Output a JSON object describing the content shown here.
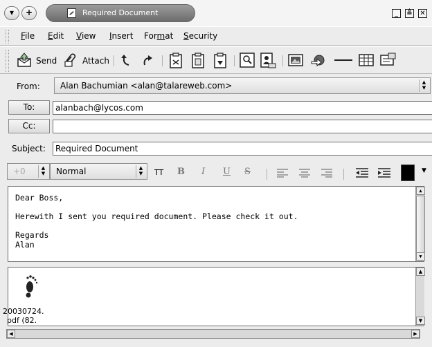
{
  "window": {
    "title": "Required Document"
  },
  "menu": {
    "file": "ile",
    "edit": "dit",
    "view": "iew",
    "insert": "nsert",
    "format_a": "For",
    "format_b": "at",
    "security": "ecurity",
    "file_key": "F",
    "edit_key": "E",
    "view_key": "V",
    "insert_key": "I",
    "format_key": "m",
    "security_key": "S"
  },
  "toolbar": {
    "send_label": "Send",
    "attach_label": "Attach"
  },
  "compose": {
    "from_label": "From:",
    "from_value": "Alan Bachumian <alan@talareweb.com>",
    "to_button": "To:",
    "to_value": "alanbach@lycos.com",
    "cc_button": "Cc:",
    "cc_value": "",
    "subject_label": "Subject:",
    "subject_value": "Required Document"
  },
  "format_toolbar": {
    "size_value": "+0",
    "style_value": "Normal",
    "tt_label": "TT",
    "bold_label": "B",
    "italic_label": "I",
    "underline_label": "U",
    "strike_label": "S",
    "color": "#000000"
  },
  "body": {
    "line1": "Dear Boss,",
    "line2": "Herewith I sent you required document. Please check it out.",
    "line3": "Regards",
    "line4": "Alan"
  },
  "attachment": {
    "icon": "footprint-icon",
    "name_line1": "20030724.",
    "name_line2": "pdf (82."
  }
}
